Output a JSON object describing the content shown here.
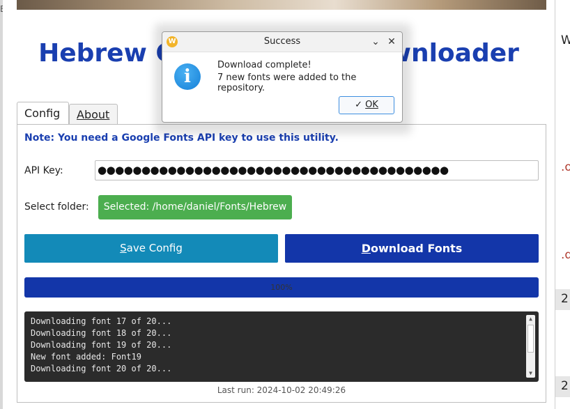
{
  "background": {
    "left_partial_glyph": "E",
    "right_partial_glyphs": [
      "W",
      ".o",
      ".d",
      "2",
      "2"
    ]
  },
  "app": {
    "title": "Hebrew Google Fonts Downloader",
    "tabs": [
      {
        "label": "Config",
        "active": true
      },
      {
        "label": "About",
        "active": false
      }
    ],
    "note": "Note: You need a Google Fonts API key to use this utility.",
    "api_key_label": "API Key:",
    "api_key_value": "●●●●●●●●●●●●●●●●●●●●●●●●●●●●●●●●●●●●●●●●",
    "select_folder_label": "Select folder:",
    "folder_button": "Selected: /home/daniel/Fonts/Hebrew",
    "save_button": "Save Config",
    "download_button": "Download Fonts",
    "progress": {
      "percent": 100,
      "label": "100%"
    },
    "log_lines": [
      "Downloading font 17 of 20...",
      "Downloading font 18 of 20...",
      "Downloading font 19 of 20...",
      "New font added: Font19",
      "Downloading font 20 of 20..."
    ],
    "last_run": "Last run: 2024-10-02 20:49:26"
  },
  "dialog": {
    "title": "Success",
    "line1": "Download complete!",
    "line2": "7 new fonts were added to the repository.",
    "ok_label": "OK",
    "app_icon_letter": "W"
  },
  "colors": {
    "title_blue": "#1a3fb0",
    "folder_green": "#4cae4f",
    "save_teal": "#138ab8",
    "download_navy": "#1336a9",
    "log_bg": "#2b2b2b"
  }
}
